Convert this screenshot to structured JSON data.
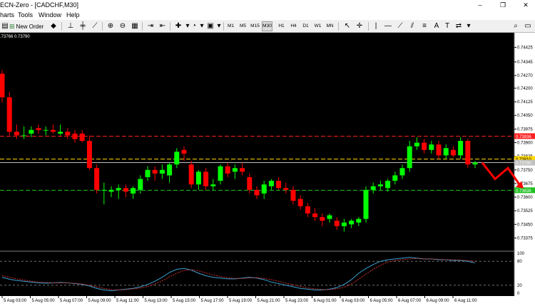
{
  "window": {
    "title": "ECN-Zero - [CADCHF,M30]",
    "minimize": "–",
    "restore": "❐",
    "close": "✕"
  },
  "menu": {
    "items": [
      "harts",
      "Tools",
      "Window",
      "Help"
    ]
  },
  "toolbar": {
    "new_order": "New Order",
    "timeframes": [
      "M1",
      "M5",
      "M15",
      "M30",
      "H1",
      "H4",
      "D1",
      "W1",
      "MN"
    ],
    "active_timeframe": "M30"
  },
  "chart_info": ".73766 0.73790",
  "colors": {
    "bull": "#00ff00",
    "bear": "#ff0000",
    "axis_bg": "#ffffff",
    "level_red": "#ff2020",
    "level_yellow": "#ffd700",
    "level_green": "#20c020",
    "bid_line": "#c0c0c0",
    "arrow": "#ff0000",
    "stoch_main": "#3ca0d0",
    "stoch_signal": "#d03030"
  },
  "chart_data": {
    "type": "candlestick",
    "symbol": "CADCHF",
    "timeframe": "M30",
    "ylim": [
      0.7331,
      0.7449
    ],
    "y_ticks": [
      "0.74425",
      "0.74345",
      "0.74270",
      "0.74200",
      "0.74125",
      "0.74050",
      "0.73975",
      "0.73900",
      "0.73825",
      "0.73750",
      "0.73675",
      "0.73600",
      "0.73525",
      "0.73450",
      "0.73375"
    ],
    "x_ticks": [
      "5 Aug 03:00",
      "5 Aug 05:00",
      "5 Aug 07:00",
      "5 Aug 09:00",
      "5 Aug 11:00",
      "5 Aug 13:00",
      "5 Aug 15:00",
      "5 Aug 17:00",
      "5 Aug 19:00",
      "5 Aug 21:00",
      "5 Aug 23:00",
      "6 Aug 01:00",
      "6 Aug 03:00",
      "6 Aug 05:00",
      "6 Aug 07:00",
      "6 Aug 09:00",
      "6 Aug 11:00"
    ],
    "levels": [
      {
        "price": 0.73936,
        "label": "0.73936",
        "color": "red"
      },
      {
        "price": 0.7381,
        "label": "0.73810",
        "color": "yellow"
      },
      {
        "price": 0.7379,
        "label": "0.73790",
        "color": "gray"
      },
      {
        "price": 0.73638,
        "label": "0.73638",
        "color": "green"
      }
    ],
    "candles": [
      {
        "o": 0.7428,
        "h": 0.743,
        "l": 0.7412,
        "c": 0.7415
      },
      {
        "o": 0.7415,
        "h": 0.7418,
        "l": 0.7394,
        "c": 0.7396
      },
      {
        "o": 0.7396,
        "h": 0.74,
        "l": 0.7392,
        "c": 0.7394
      },
      {
        "o": 0.7394,
        "h": 0.7399,
        "l": 0.7392,
        "c": 0.7394
      },
      {
        "o": 0.7395,
        "h": 0.7399,
        "l": 0.7393,
        "c": 0.7397
      },
      {
        "o": 0.7398,
        "h": 0.74,
        "l": 0.7395,
        "c": 0.7397
      },
      {
        "o": 0.7397,
        "h": 0.7399,
        "l": 0.7394,
        "c": 0.7397
      },
      {
        "o": 0.7397,
        "h": 0.74,
        "l": 0.7395,
        "c": 0.7396
      },
      {
        "o": 0.7395,
        "h": 0.74,
        "l": 0.7394,
        "c": 0.7396
      },
      {
        "o": 0.7396,
        "h": 0.7398,
        "l": 0.7392,
        "c": 0.7394
      },
      {
        "o": 0.7395,
        "h": 0.7397,
        "l": 0.739,
        "c": 0.7392
      },
      {
        "o": 0.7395,
        "h": 0.7397,
        "l": 0.739,
        "c": 0.7391
      },
      {
        "o": 0.7391,
        "h": 0.7394,
        "l": 0.7375,
        "c": 0.7376
      },
      {
        "o": 0.7376,
        "h": 0.7378,
        "l": 0.7362,
        "c": 0.7364
      },
      {
        "o": 0.7364,
        "h": 0.7368,
        "l": 0.7356,
        "c": 0.7364
      },
      {
        "o": 0.7363,
        "h": 0.7366,
        "l": 0.736,
        "c": 0.7364
      },
      {
        "o": 0.7364,
        "h": 0.7367,
        "l": 0.7359,
        "c": 0.7365
      },
      {
        "o": 0.7365,
        "h": 0.7367,
        "l": 0.736,
        "c": 0.7363
      },
      {
        "o": 0.7362,
        "h": 0.7366,
        "l": 0.7359,
        "c": 0.7365
      },
      {
        "o": 0.7364,
        "h": 0.7372,
        "l": 0.7362,
        "c": 0.737
      },
      {
        "o": 0.7371,
        "h": 0.7377,
        "l": 0.7369,
        "c": 0.7375
      },
      {
        "o": 0.7375,
        "h": 0.7377,
        "l": 0.7369,
        "c": 0.7373
      },
      {
        "o": 0.7373,
        "h": 0.7378,
        "l": 0.737,
        "c": 0.7375
      },
      {
        "o": 0.7372,
        "h": 0.7379,
        "l": 0.7368,
        "c": 0.7378
      },
      {
        "o": 0.7378,
        "h": 0.7387,
        "l": 0.7376,
        "c": 0.7385
      },
      {
        "o": 0.7386,
        "h": 0.7388,
        "l": 0.738,
        "c": 0.7384
      },
      {
        "o": 0.7378,
        "h": 0.738,
        "l": 0.7365,
        "c": 0.7367
      },
      {
        "o": 0.7367,
        "h": 0.7375,
        "l": 0.7364,
        "c": 0.7374
      },
      {
        "o": 0.7374,
        "h": 0.7376,
        "l": 0.7364,
        "c": 0.7366
      },
      {
        "o": 0.7366,
        "h": 0.737,
        "l": 0.7364,
        "c": 0.7367
      },
      {
        "o": 0.7369,
        "h": 0.7378,
        "l": 0.7367,
        "c": 0.7377
      },
      {
        "o": 0.7377,
        "h": 0.7379,
        "l": 0.7371,
        "c": 0.7373
      },
      {
        "o": 0.7374,
        "h": 0.7378,
        "l": 0.737,
        "c": 0.7376
      },
      {
        "o": 0.7376,
        "h": 0.7379,
        "l": 0.7372,
        "c": 0.7374
      },
      {
        "o": 0.7371,
        "h": 0.7373,
        "l": 0.7362,
        "c": 0.7364
      },
      {
        "o": 0.7364,
        "h": 0.7366,
        "l": 0.7359,
        "c": 0.7361
      },
      {
        "o": 0.7362,
        "h": 0.7369,
        "l": 0.7359,
        "c": 0.7367
      },
      {
        "o": 0.7366,
        "h": 0.737,
        "l": 0.7364,
        "c": 0.7369
      },
      {
        "o": 0.7369,
        "h": 0.7371,
        "l": 0.7364,
        "c": 0.7365
      },
      {
        "o": 0.7365,
        "h": 0.7368,
        "l": 0.7362,
        "c": 0.7364
      },
      {
        "o": 0.7364,
        "h": 0.7366,
        "l": 0.7356,
        "c": 0.7358
      },
      {
        "o": 0.7359,
        "h": 0.7361,
        "l": 0.7353,
        "c": 0.7355
      },
      {
        "o": 0.7355,
        "h": 0.7357,
        "l": 0.7349,
        "c": 0.7351
      },
      {
        "o": 0.7351,
        "h": 0.7354,
        "l": 0.7347,
        "c": 0.7349
      },
      {
        "o": 0.7349,
        "h": 0.7351,
        "l": 0.7344,
        "c": 0.7347
      },
      {
        "o": 0.7348,
        "h": 0.7351,
        "l": 0.7346,
        "c": 0.735
      },
      {
        "o": 0.7347,
        "h": 0.7349,
        "l": 0.7342,
        "c": 0.7344
      },
      {
        "o": 0.7344,
        "h": 0.7348,
        "l": 0.7341,
        "c": 0.7346
      },
      {
        "o": 0.7345,
        "h": 0.7348,
        "l": 0.7343,
        "c": 0.7347
      },
      {
        "o": 0.7346,
        "h": 0.7349,
        "l": 0.7344,
        "c": 0.7348
      },
      {
        "o": 0.7348,
        "h": 0.7366,
        "l": 0.7346,
        "c": 0.7364
      },
      {
        "o": 0.7364,
        "h": 0.7368,
        "l": 0.7362,
        "c": 0.7366
      },
      {
        "o": 0.7366,
        "h": 0.7369,
        "l": 0.7364,
        "c": 0.7367
      },
      {
        "o": 0.7365,
        "h": 0.737,
        "l": 0.7363,
        "c": 0.7369
      },
      {
        "o": 0.7369,
        "h": 0.7374,
        "l": 0.7367,
        "c": 0.7372
      },
      {
        "o": 0.7372,
        "h": 0.7378,
        "l": 0.737,
        "c": 0.7376
      },
      {
        "o": 0.7376,
        "h": 0.7391,
        "l": 0.7374,
        "c": 0.7388
      },
      {
        "o": 0.7388,
        "h": 0.7393,
        "l": 0.7386,
        "c": 0.739
      },
      {
        "o": 0.739,
        "h": 0.7392,
        "l": 0.7384,
        "c": 0.7386
      },
      {
        "o": 0.7386,
        "h": 0.7391,
        "l": 0.7384,
        "c": 0.7389
      },
      {
        "o": 0.7389,
        "h": 0.7391,
        "l": 0.7381,
        "c": 0.7383
      },
      {
        "o": 0.7383,
        "h": 0.7389,
        "l": 0.7381,
        "c": 0.7387
      },
      {
        "o": 0.7386,
        "h": 0.7388,
        "l": 0.7382,
        "c": 0.7383
      },
      {
        "o": 0.7383,
        "h": 0.7393,
        "l": 0.7381,
        "c": 0.7391
      },
      {
        "o": 0.7391,
        "h": 0.7392,
        "l": 0.7376,
        "c": 0.7378
      },
      {
        "o": 0.7378,
        "h": 0.738,
        "l": 0.7376,
        "c": 0.7379
      }
    ],
    "projection": [
      0.7379,
      0.737,
      0.7376,
      0.7366
    ],
    "stochastic": {
      "levels": [
        100,
        80,
        20,
        0
      ],
      "main": [
        40,
        35,
        32,
        30,
        28,
        26,
        25,
        26,
        27,
        26,
        24,
        22,
        18,
        12,
        8,
        6,
        8,
        10,
        12,
        16,
        22,
        30,
        40,
        52,
        60,
        62,
        58,
        50,
        44,
        40,
        38,
        36,
        36,
        38,
        40,
        38,
        34,
        28,
        24,
        20,
        16,
        12,
        10,
        8,
        8,
        10,
        14,
        22,
        34,
        50,
        62,
        72,
        80,
        84,
        86,
        88,
        90,
        88,
        86,
        86,
        84,
        84,
        82,
        82,
        80,
        76
      ],
      "signal": [
        44,
        40,
        36,
        33,
        30,
        28,
        27,
        26,
        26,
        26,
        25,
        23,
        20,
        16,
        12,
        9,
        8,
        9,
        11,
        13,
        17,
        23,
        31,
        41,
        50,
        57,
        59,
        56,
        51,
        46,
        42,
        39,
        37,
        37,
        38,
        39,
        37,
        34,
        30,
        25,
        21,
        17,
        13,
        11,
        9,
        9,
        11,
        15,
        23,
        35,
        48,
        60,
        70,
        78,
        82,
        84,
        86,
        87,
        86,
        86,
        85,
        84,
        84,
        83,
        82,
        80
      ]
    }
  }
}
